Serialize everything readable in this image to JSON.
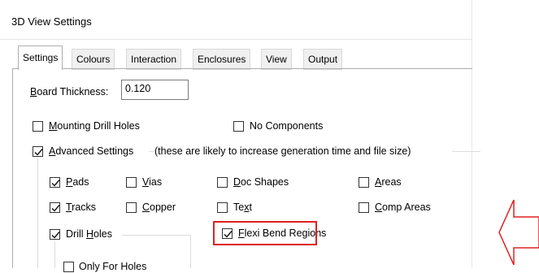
{
  "window": {
    "title": "3D View Settings"
  },
  "tabs": [
    {
      "label": "Settings",
      "active": true
    },
    {
      "label": "Colours",
      "active": false
    },
    {
      "label": "Interaction",
      "active": false
    },
    {
      "label": "Enclosures",
      "active": false
    },
    {
      "label": "View",
      "active": false
    },
    {
      "label": "Output",
      "active": false
    }
  ],
  "board_thickness": {
    "label_first": "B",
    "label_rest": "oard Thickness:",
    "value": "0.120"
  },
  "mounting_drill_holes": {
    "first": "M",
    "rest": "ounting Drill Holes",
    "checked": false
  },
  "no_components": {
    "label": "No Components",
    "checked": false
  },
  "advanced_settings": {
    "first": "A",
    "rest": "dvanced Settings",
    "note": "(these are likely to increase generation time and file size)",
    "checked": true
  },
  "options": {
    "pads": {
      "first": "P",
      "rest": "ads",
      "checked": true
    },
    "vias": {
      "first": "V",
      "rest": "ias",
      "checked": false
    },
    "doc_shapes": {
      "first": "D",
      "rest": "oc Shapes",
      "checked": false
    },
    "areas": {
      "first": "A",
      "rest": "reas",
      "checked": false
    },
    "tracks": {
      "first": "T",
      "rest": "racks",
      "checked": true
    },
    "copper": {
      "first": "C",
      "rest": "opper",
      "checked": false
    },
    "text": {
      "before": "Te",
      "ul": "x",
      "after": "t",
      "checked": false
    },
    "comp_areas": {
      "first": "C",
      "rest": "omp Areas",
      "checked": false
    },
    "drill_holes": {
      "before": "Drill ",
      "ul": "H",
      "after": "oles",
      "checked": true
    },
    "flexi_bend_regions": {
      "first": "F",
      "rest": "lexi Bend Regions",
      "checked": true
    }
  },
  "partial_text": "Only For Holes",
  "colors": {
    "highlight": "#e02020",
    "arrow": "#e02020"
  }
}
